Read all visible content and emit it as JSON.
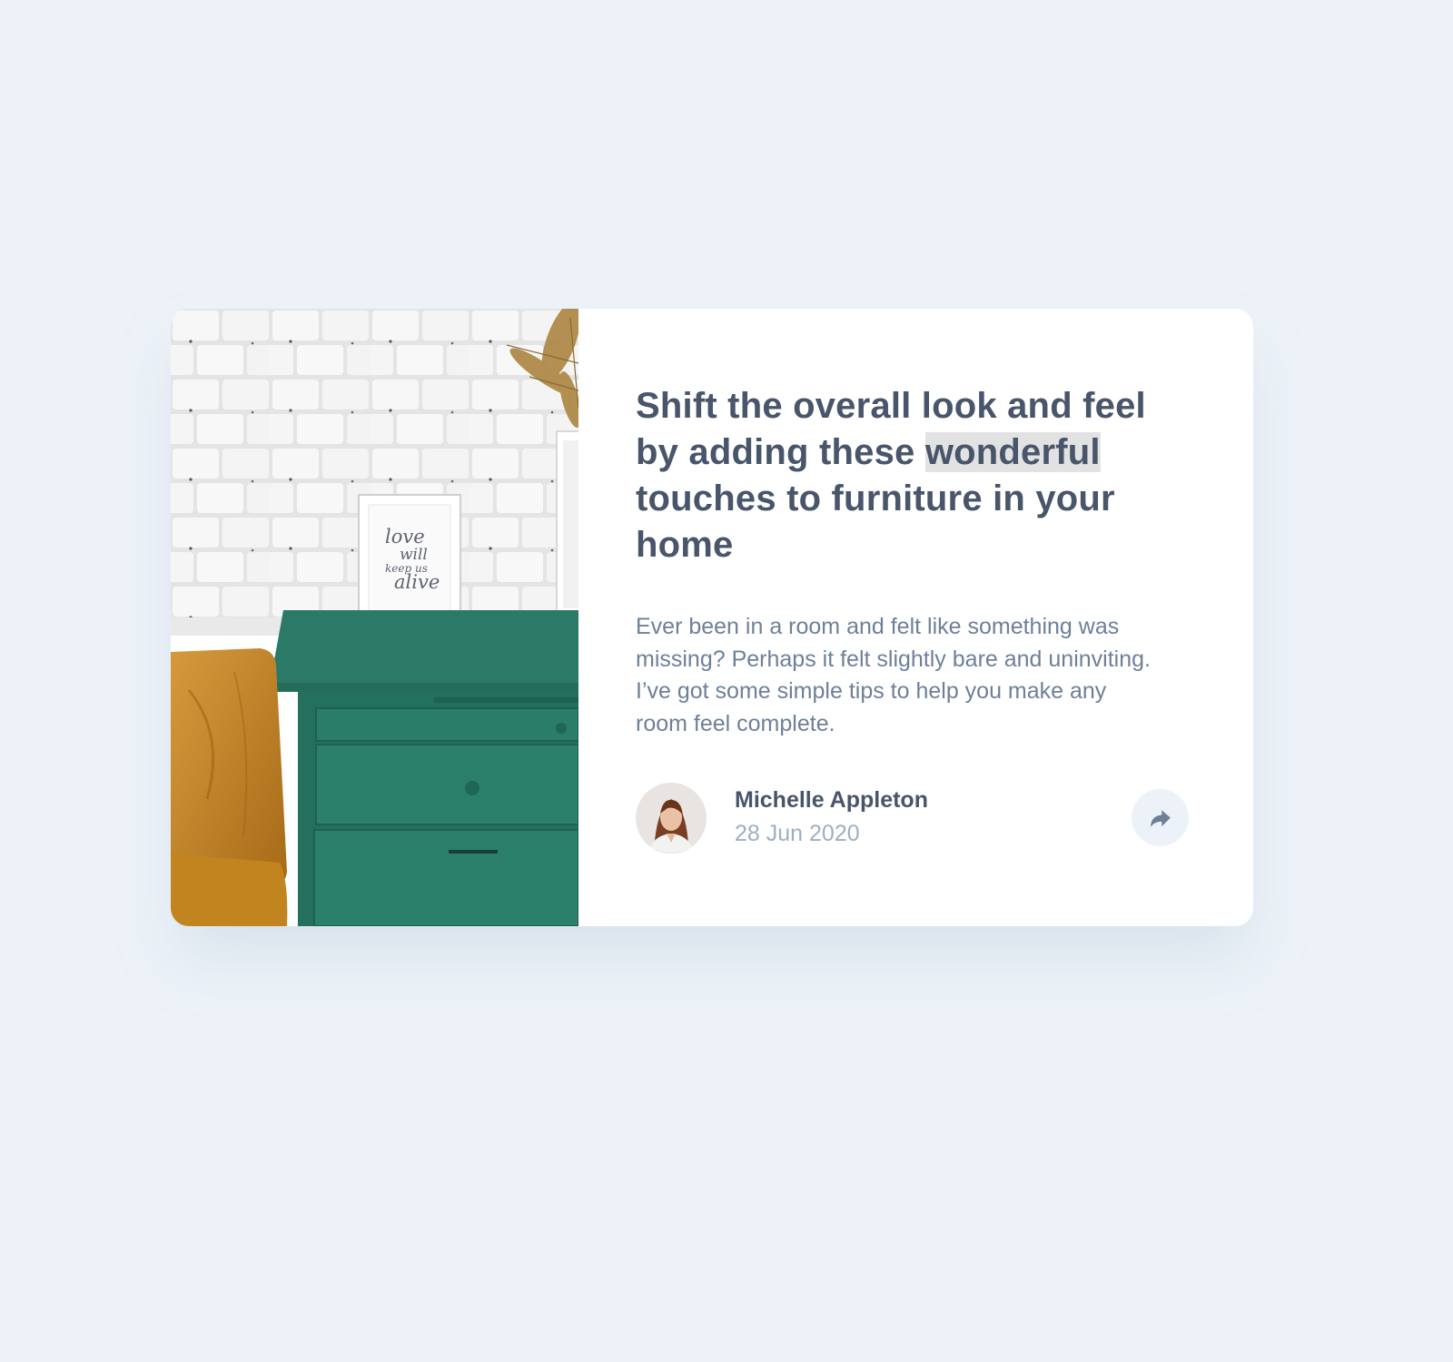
{
  "article": {
    "title_before": "Shift the overall look and feel by adding these ",
    "title_highlight": "wonderful",
    "title_after": " touches to furniture in your home",
    "excerpt": "Ever been in a room and felt like something was missing? Perhaps it felt slightly bare and uninviting. I’ve got some simple tips to help you make any room feel complete.",
    "image_frame_text": [
      "love",
      "will",
      "keep us",
      "alive"
    ]
  },
  "author": {
    "name": "Michelle Appleton",
    "date": "28 Jun 2020"
  },
  "share": {
    "icon": "share-icon"
  },
  "colors": {
    "background": "#ecf2f8",
    "card": "#ffffff",
    "heading": "#48556a",
    "body_text": "#6e8098",
    "muted_text": "#9eafc2",
    "share_bg": "#ecf2f8",
    "share_icon": "#6e8098",
    "highlight": "#e2e2e2",
    "dresser": "#2a7b68"
  }
}
